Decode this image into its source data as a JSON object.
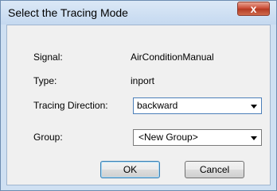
{
  "window": {
    "title": "Select the Tracing Mode",
    "close_glyph": "x"
  },
  "fields": {
    "signal_label": "Signal:",
    "signal_value": "AirConditionManual",
    "type_label": "Type:",
    "type_value": "inport",
    "direction_label": "Tracing Direction:",
    "direction_value": "backward",
    "group_label": "Group:",
    "group_value": "<New Group>"
  },
  "buttons": {
    "ok_label": "OK",
    "cancel_label": "Cancel"
  },
  "colors": {
    "title_bar": "#c5d9f0",
    "close_button": "#c8452f",
    "dialog_background": "#f0f0f0"
  }
}
